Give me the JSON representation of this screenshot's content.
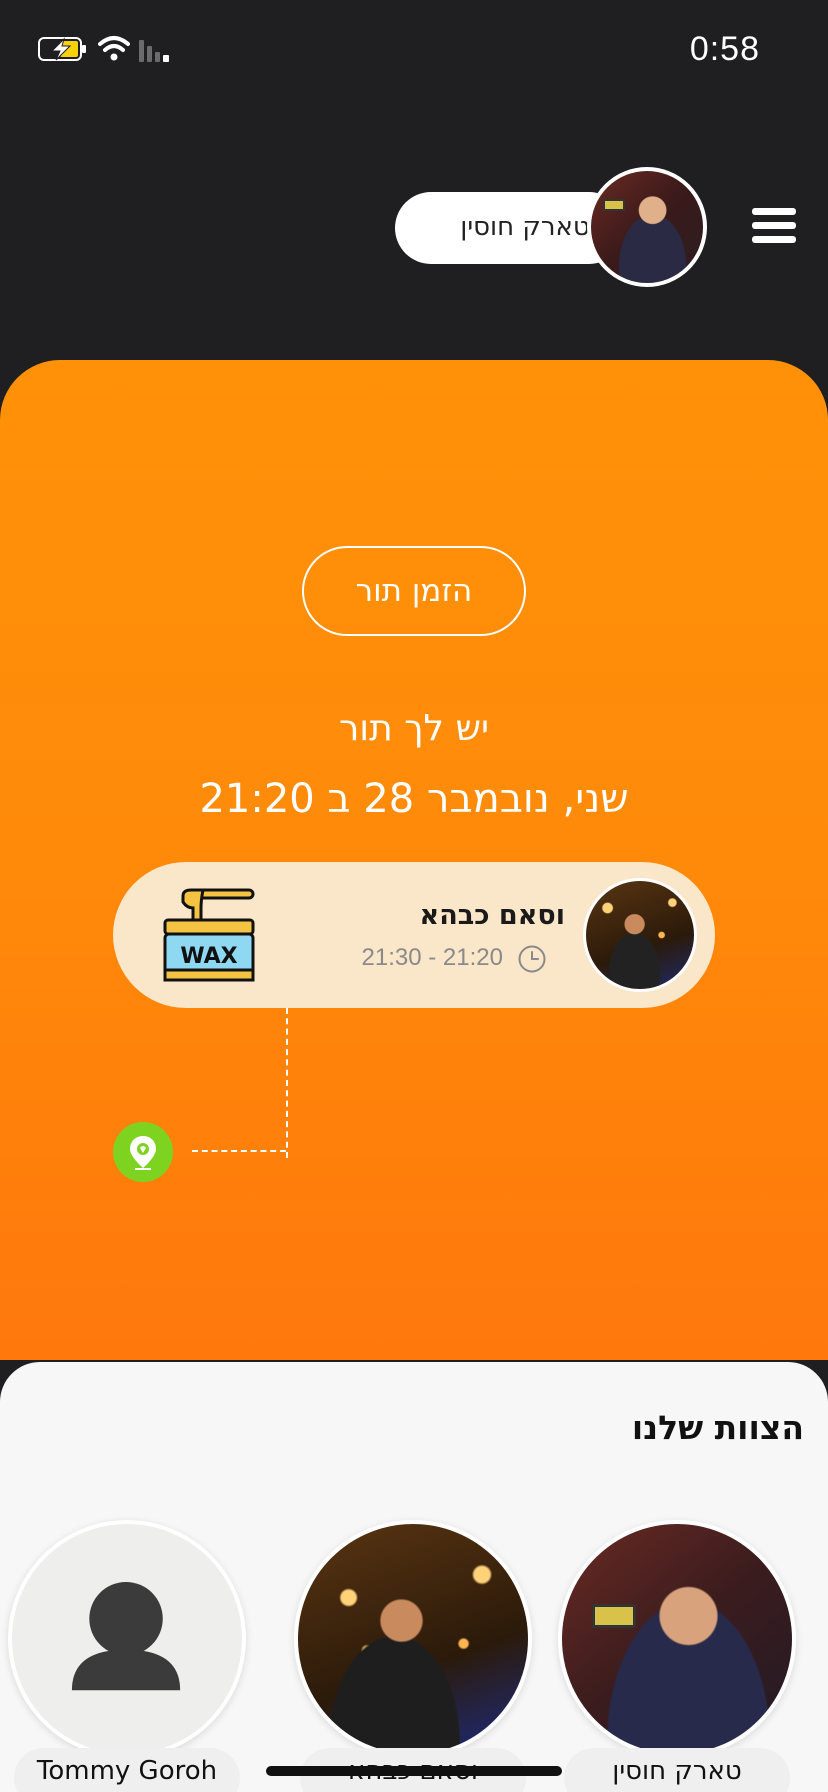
{
  "status_bar": {
    "time": "0:58"
  },
  "header": {
    "user_name": "טארק חוסין"
  },
  "booking": {
    "book_button_label": "הזמן תור",
    "have_appointment_text": "יש לך תור",
    "appointment_date": "שני, נובמבר 28 ב 21:20",
    "appointment": {
      "barber_name": "וסאם כבהא",
      "time_range": "21:30 - 21:20",
      "service_icon": "wax-icon",
      "service_icon_text": "WAX"
    }
  },
  "team": {
    "title": "הצוות שלנו",
    "members": [
      {
        "name": "טארק חוסין"
      },
      {
        "name": "וסאם כבהא"
      },
      {
        "name": "Tommy Goroh"
      }
    ]
  },
  "colors": {
    "accent_orange": "#ff8a0a",
    "location_green": "#7ed321",
    "header_dark": "#1f1e20"
  }
}
